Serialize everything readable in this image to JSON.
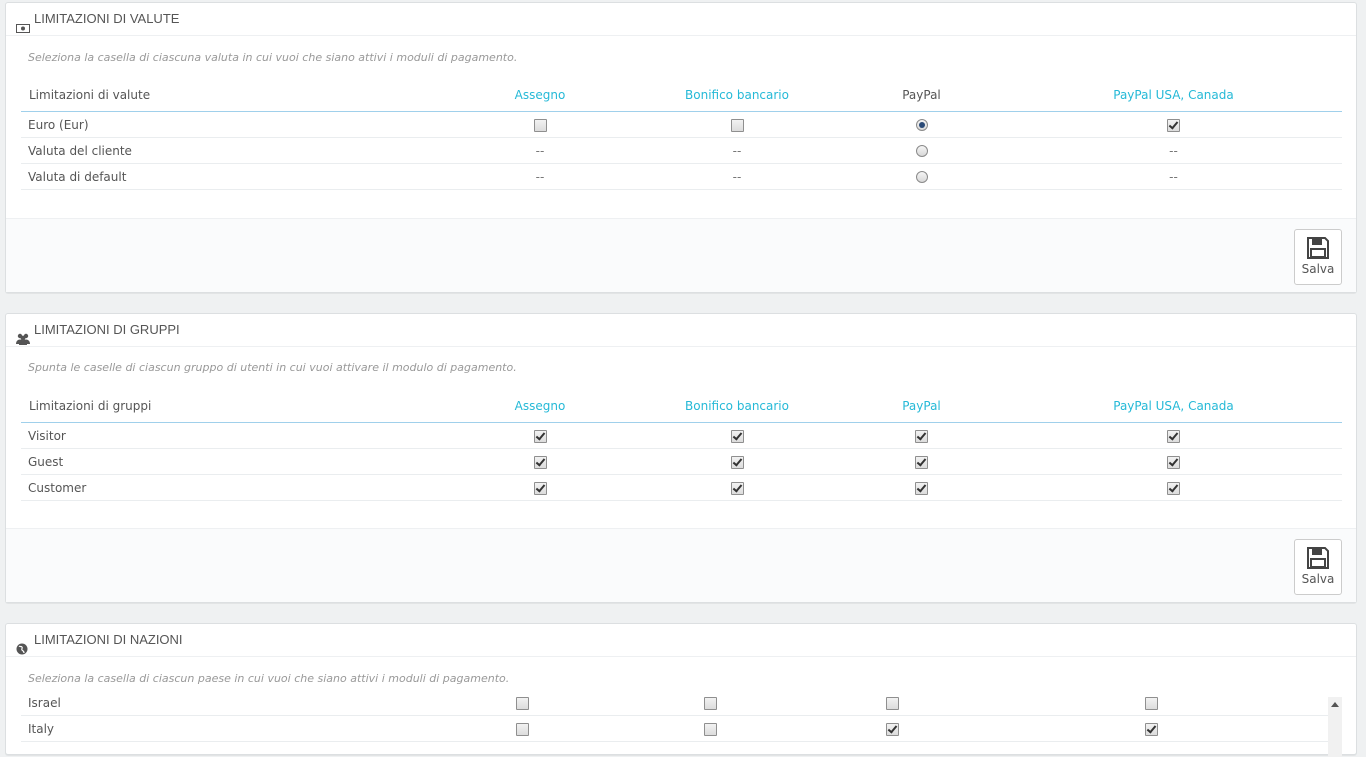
{
  "currency_panel": {
    "title": "LIMITAZIONI DI VALUTE",
    "help": "Seleziona la casella di ciascuna valuta in cui vuoi che siano attivi i moduli di pagamento.",
    "col_header": "Limitazioni di valute",
    "modules": [
      "Assegno",
      "Bonifico bancario",
      "PayPal",
      "PayPal USA, Canada"
    ],
    "rows": [
      {
        "label": "Euro (Eur)",
        "cells": [
          "checkbox-off",
          "checkbox-off",
          "radio-on",
          "checkbox-on"
        ]
      },
      {
        "label": "Valuta del cliente",
        "cells": [
          "--",
          "--",
          "radio-off",
          "--"
        ]
      },
      {
        "label": "Valuta di default",
        "cells": [
          "--",
          "--",
          "radio-off",
          "--"
        ]
      }
    ],
    "save_label": "Salva"
  },
  "groups_panel": {
    "title": "LIMITAZIONI DI GRUPPI",
    "help": "Spunta le caselle di ciascun gruppo di utenti in cui vuoi attivare il modulo di pagamento.",
    "col_header": "Limitazioni di gruppi",
    "modules": [
      "Assegno",
      "Bonifico bancario",
      "PayPal",
      "PayPal USA, Canada"
    ],
    "rows": [
      {
        "label": "Visitor",
        "cells": [
          "checkbox-on",
          "checkbox-on",
          "checkbox-on",
          "checkbox-on"
        ]
      },
      {
        "label": "Guest",
        "cells": [
          "checkbox-on",
          "checkbox-on",
          "checkbox-on",
          "checkbox-on"
        ]
      },
      {
        "label": "Customer",
        "cells": [
          "checkbox-on",
          "checkbox-on",
          "checkbox-on",
          "checkbox-on"
        ]
      }
    ],
    "save_label": "Salva"
  },
  "countries_panel": {
    "title": "LIMITAZIONI DI NAZIONI",
    "help": "Seleziona la casella di ciascun paese in cui vuoi che siano attivi i moduli di pagamento.",
    "rows": [
      {
        "label": "Israel",
        "cells": [
          "checkbox-off",
          "checkbox-off",
          "checkbox-off",
          "checkbox-off"
        ]
      },
      {
        "label": "Italy",
        "cells": [
          "checkbox-off",
          "checkbox-off",
          "checkbox-on",
          "checkbox-on"
        ]
      }
    ]
  },
  "colors": {
    "link": "#25b9d7",
    "header_rule": "#a0d0eb",
    "background": "#eff1f2"
  }
}
